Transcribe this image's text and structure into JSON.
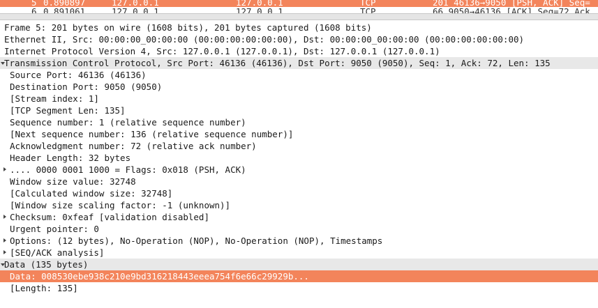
{
  "packet_list": {
    "selected": {
      "no": "5",
      "time": "0.890897",
      "src": "127.0.0.1",
      "dst": "127.0.0.1",
      "proto": "TCP",
      "info": "201 46136→9050 [PSH, ACK] Seq="
    },
    "next": {
      "no": "6",
      "time": "0.891061",
      "src": "127.0.0.1",
      "dst": "127.0.0.1",
      "proto": "TCP",
      "info": "66 9050→46136 [ACK] Seq=72 Ack"
    }
  },
  "details": {
    "frame": "Frame 5: 201 bytes on wire (1608 bits), 201 bytes captured (1608 bits)",
    "ethernet": "Ethernet II, Src: 00:00:00_00:00:00 (00:00:00:00:00:00), Dst: 00:00:00_00:00:00 (00:00:00:00:00:00)",
    "ipv4": "Internet Protocol Version 4, Src: 127.0.0.1 (127.0.0.1), Dst: 127.0.0.1 (127.0.0.1)",
    "tcp": "Transmission Control Protocol, Src Port: 46136 (46136), Dst Port: 9050 (9050), Seq: 1, Ack: 72, Len: 135",
    "src_port": "Source Port: 46136 (46136)",
    "dst_port": "Destination Port: 9050 (9050)",
    "stream_index": "[Stream index: 1]",
    "seg_len": "[TCP Segment Len: 135]",
    "seq": "Sequence number: 1    (relative sequence number)",
    "next_seq": "[Next sequence number: 136    (relative sequence number)]",
    "ack": "Acknowledgment number: 72    (relative ack number)",
    "header_len": "Header Length: 32 bytes",
    "flags": ".... 0000 0001 1000 = Flags: 0x018 (PSH, ACK)",
    "window": "Window size value: 32748",
    "calc_window": "[Calculated window size: 32748]",
    "scaling": "[Window size scaling factor: -1 (unknown)]",
    "checksum": "Checksum: 0xfeaf [validation disabled]",
    "urgent": "Urgent pointer: 0",
    "options": "Options: (12 bytes), No-Operation (NOP), No-Operation (NOP), Timestamps",
    "seqack": "[SEQ/ACK analysis]",
    "data": "Data (135 bytes)",
    "data_value": "Data: 008530ebe938c210e9bd316218443eeea754f6e66c29929b...",
    "length": "[Length: 135]"
  }
}
